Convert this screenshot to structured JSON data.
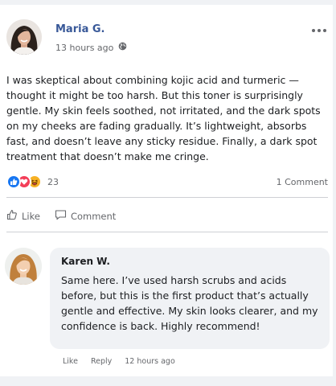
{
  "post": {
    "author": "Maria G.",
    "timestamp": "13 hours ago",
    "privacy_icon": "globe-icon",
    "more_icon": "more-options-icon",
    "text": "I was skeptical about combining kojic acid and turmeric — thought it might be too harsh. But this toner is surprisingly gentle. My skin feels soothed, not irritated, and the dark spots on my cheeks are fading gradually. It’s lightweight, absorbs fast, and doesn’t leave any sticky residue. Finally, a dark spot treatment that doesn’t make me cringe.",
    "reaction_icons": [
      "like-reaction-icon",
      "love-reaction-icon",
      "haha-reaction-icon"
    ],
    "reaction_count": "23",
    "comment_count": "1 Comment"
  },
  "actions": {
    "like_label": "Like",
    "comment_label": "Comment"
  },
  "comment": {
    "author": "Karen W.",
    "text": "Same here. I’ve used harsh scrubs and acids before, but this is the first product that’s actually gentle and effective. My skin looks clearer, and my confidence is back. Highly recommend!",
    "like_label": "Like",
    "reply_label": "Reply",
    "timestamp": "12 hours ago"
  },
  "colors": {
    "author_name": "#385898",
    "like_blue": "#1877f2",
    "love_red": "#f33e58",
    "haha_yellow": "#f7b125",
    "background": "#f0f2f5"
  }
}
